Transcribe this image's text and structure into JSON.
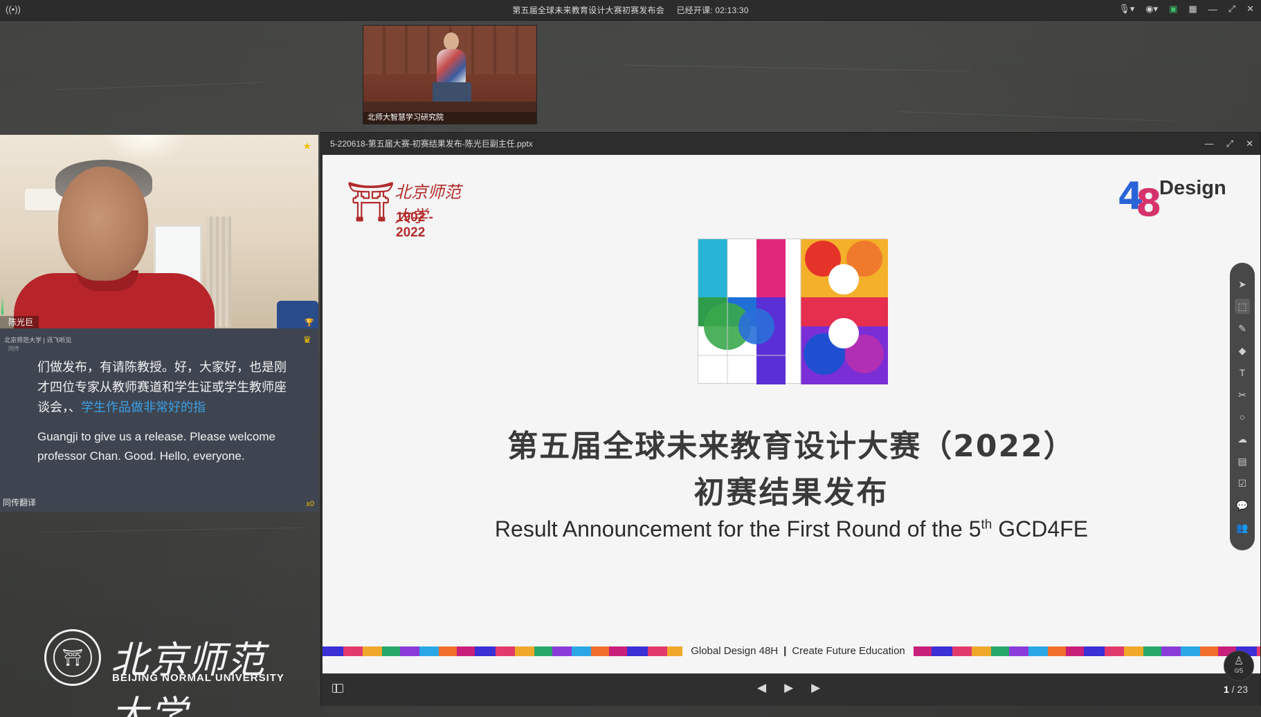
{
  "topbar": {
    "title": "第五届全球未来教育设计大赛初赛发布会",
    "elapsed_label": "已经开课: 02:13:30"
  },
  "teacher_cam": {
    "label": "北师大智慧学习研究院"
  },
  "professor": {
    "name": "陈光巨"
  },
  "translation": {
    "header": "北京师范大学 | 讯飞听见",
    "subheader": "同传",
    "zh_text_plain": "们做发布，有请陈教授。好，大家好，也是刚才四位专家从教师赛道和学生证或学生教师座谈会，、",
    "zh_text_highlight": "学生作品做非常好的指",
    "en_text": "Guangji to give us a release. Please welcome professor Chan. Good. Hello, everyone.",
    "footer_label": "同传翻译",
    "footer_count": "x0"
  },
  "bnu_logo": {
    "name_zh": "北京师范大学",
    "name_en": "BEIJING NORMAL UNIVERSITY"
  },
  "slide_window": {
    "filename": "5-220618-第五届大赛-初赛结果发布-陈光巨副主任.pptx",
    "page_current": "1",
    "page_total": "/ 23"
  },
  "slide": {
    "bnu_name": "北京师范大学",
    "bnu_years": "1902 - 2022",
    "design_word": "Design",
    "title_zh1": "第五届全球未来教育设计大赛（2022）",
    "title_zh2": "初赛结果发布",
    "title_en_pre": "Result Announcement for the First Round of the 5",
    "title_en_sup": "th",
    "title_en_post": " GCD4FE",
    "footer_left": "Global Design 48H",
    "footer_right": "Create Future Education"
  },
  "user_bubble": {
    "count": "0/5"
  },
  "colors": {
    "accent_blue": "#3aa0e8",
    "bnu_red": "#b32b2b",
    "crown_gold": "#f2c100",
    "shirt_red": "#b7252a"
  },
  "icons": [
    "live-icon",
    "mic-icon",
    "camera-icon",
    "record-icon",
    "grid-icon",
    "minimize-icon",
    "fullscreen-icon",
    "close-icon",
    "crown-icon",
    "prev-icon",
    "play-icon",
    "next-icon",
    "pointer-icon",
    "select-icon",
    "pen-icon",
    "eraser-icon",
    "text-icon",
    "scissors-icon",
    "circle-icon",
    "cloud-icon",
    "box-icon",
    "edit-icon",
    "chat-icon",
    "users-icon"
  ]
}
